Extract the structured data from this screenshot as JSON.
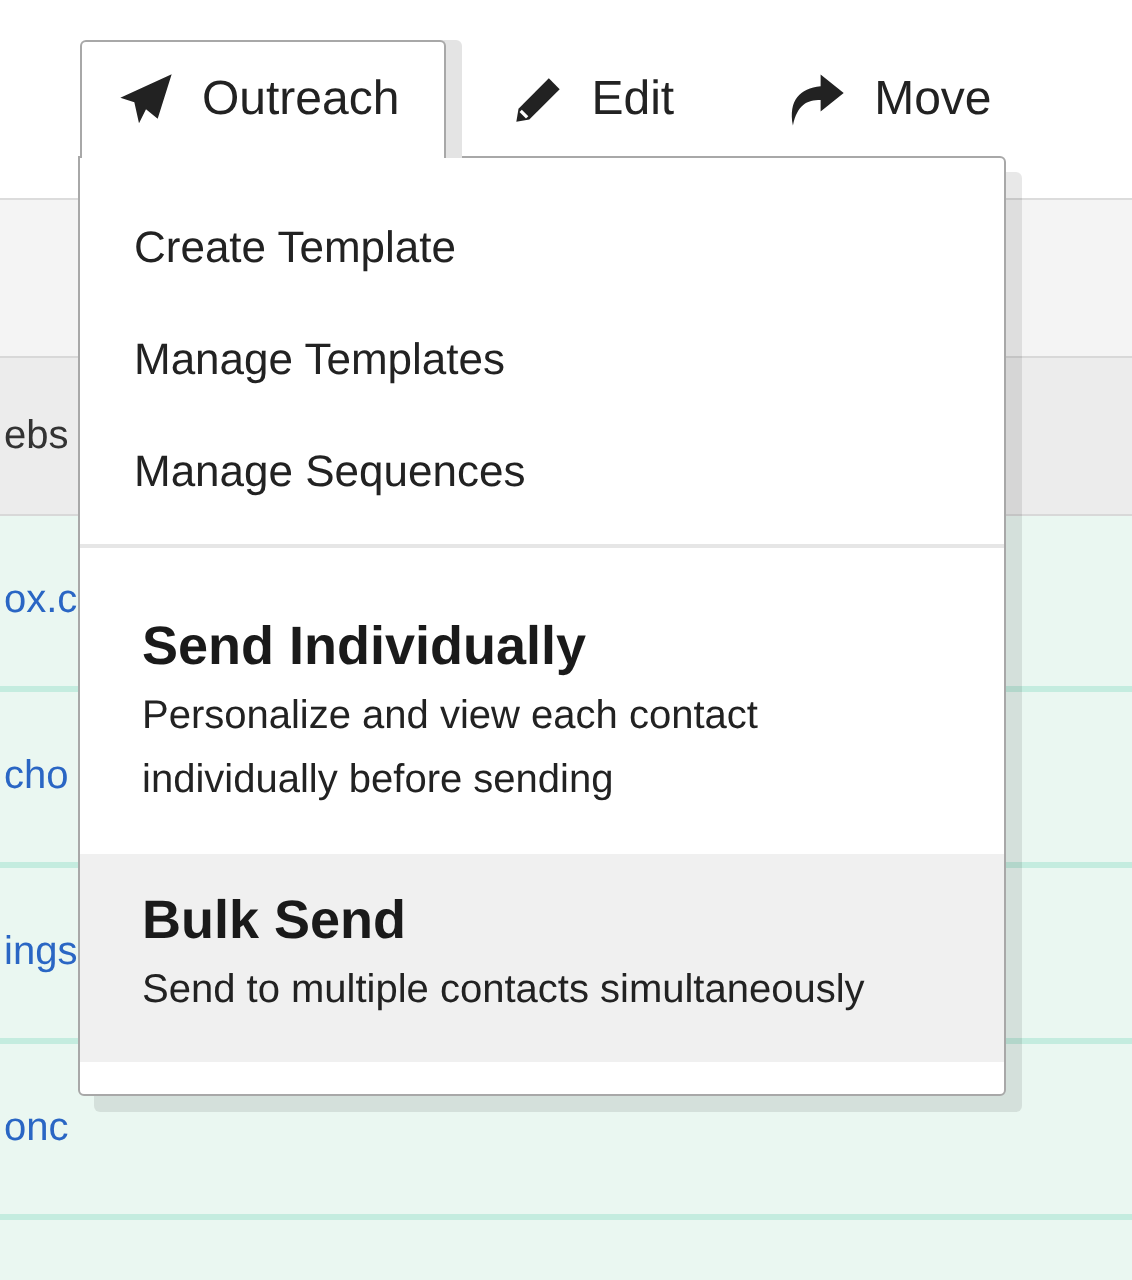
{
  "tabs": [
    {
      "label": "Outreach",
      "kind": "send",
      "selected": true
    },
    {
      "label": "Edit",
      "kind": "pencil",
      "selected": false
    },
    {
      "label": "Move",
      "kind": "share",
      "selected": false
    }
  ],
  "table": {
    "column_header": "ebs",
    "rows": [
      {
        "link": "ox.c"
      },
      {
        "link": "cho"
      },
      {
        "link": "ings"
      },
      {
        "link": "onc"
      }
    ]
  },
  "menu": {
    "items": [
      {
        "label": "Create Template"
      },
      {
        "label": "Manage Templates"
      },
      {
        "label": "Manage Sequences"
      }
    ],
    "options": [
      {
        "title": "Send Individually",
        "description": "Personalize and view each contact individually before sending",
        "selected": false
      },
      {
        "title": "Bulk Send",
        "description": "Send to multiple contacts simultaneously",
        "selected": true
      }
    ]
  }
}
